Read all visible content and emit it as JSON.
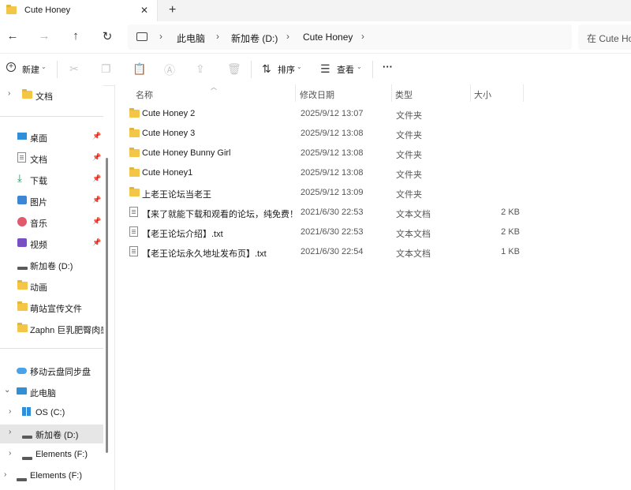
{
  "tab": {
    "title": "Cute Honey",
    "close": "✕",
    "new": "+"
  },
  "nav": {
    "back": "←",
    "forward": "→",
    "up": "↑",
    "refresh": "↻"
  },
  "breadcrumb": [
    "此电脑",
    "新加卷 (D:)",
    "Cute Honey"
  ],
  "search": {
    "placeholder": "在 Cute Ho"
  },
  "toolbar": {
    "new_label": "新建",
    "sort_label": "排序",
    "view_label": "查看",
    "more": "···"
  },
  "sidebar": {
    "top": [
      {
        "label": "文档",
        "icon": "folder-icon"
      }
    ],
    "quick": [
      {
        "label": "桌面",
        "icon": "desktop-icon",
        "pinned": true
      },
      {
        "label": "文档",
        "icon": "document-icon",
        "pinned": true
      },
      {
        "label": "下载",
        "icon": "download-icon",
        "pinned": true
      },
      {
        "label": "图片",
        "icon": "pictures-icon",
        "pinned": true
      },
      {
        "label": "音乐",
        "icon": "music-icon",
        "pinned": true
      },
      {
        "label": "视频",
        "icon": "video-icon",
        "pinned": true
      },
      {
        "label": "新加卷 (D:)",
        "icon": "drive-icon",
        "pinned": false
      },
      {
        "label": "动画",
        "icon": "folder-icon",
        "pinned": false
      },
      {
        "label": "萌站宣传文件",
        "icon": "folder-icon",
        "pinned": false
      },
      {
        "label": "Zaphn 巨乳肥臀肉感",
        "icon": "folder-icon",
        "pinned": false
      }
    ],
    "cloud": "移动云盘同步盘",
    "pc": "此电脑",
    "drives": [
      {
        "label": "OS (C:)",
        "selected": false
      },
      {
        "label": "新加卷 (D:)",
        "selected": true
      },
      {
        "label": "Elements (F:)",
        "selected": false
      }
    ],
    "external": "Elements (F:)"
  },
  "columns": {
    "name": "名称",
    "date": "修改日期",
    "type": "类型",
    "size": "大小"
  },
  "files": [
    {
      "name": "Cute Honey 2",
      "date": "2025/9/12 13:07",
      "type": "文件夹",
      "size": "",
      "kind": "folder"
    },
    {
      "name": "Cute Honey 3",
      "date": "2025/9/12 13:08",
      "type": "文件夹",
      "size": "",
      "kind": "folder"
    },
    {
      "name": "Cute Honey Bunny Girl",
      "date": "2025/9/12 13:08",
      "type": "文件夹",
      "size": "",
      "kind": "folder"
    },
    {
      "name": "Cute Honey1",
      "date": "2025/9/12 13:08",
      "type": "文件夹",
      "size": "",
      "kind": "folder"
    },
    {
      "name": "上老王论坛当老王",
      "date": "2025/9/12 13:09",
      "type": "文件夹",
      "size": "",
      "kind": "folder"
    },
    {
      "name": "【来了就能下载和观看的论坛，纯免费！...",
      "date": "2021/6/30 22:53",
      "type": "文本文档",
      "size": "2 KB",
      "kind": "text"
    },
    {
      "name": "【老王论坛介绍】.txt",
      "date": "2021/6/30 22:53",
      "type": "文本文档",
      "size": "2 KB",
      "kind": "text"
    },
    {
      "name": "【老王论坛永久地址发布页】.txt",
      "date": "2021/6/30 22:54",
      "type": "文本文档",
      "size": "1 KB",
      "kind": "text"
    }
  ]
}
